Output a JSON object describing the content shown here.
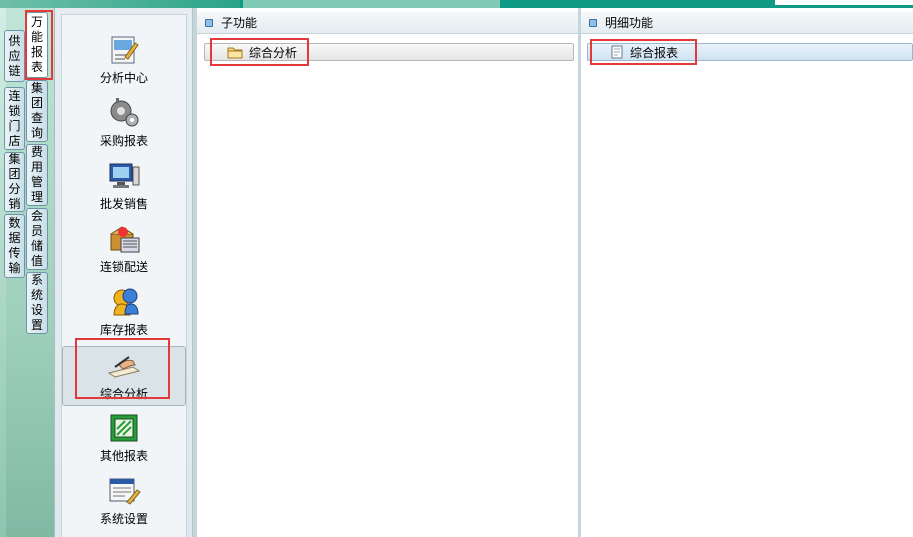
{
  "left_tabs": [
    {
      "label": "供应链"
    },
    {
      "label": "连锁门店"
    },
    {
      "label": "集团分销"
    },
    {
      "label": "数据传输"
    }
  ],
  "right_tabs": [
    {
      "label": "万能报表"
    },
    {
      "label": "集团查询"
    },
    {
      "label": "费用管理"
    },
    {
      "label": "会员储值"
    },
    {
      "label": "系统设置"
    }
  ],
  "nav": [
    {
      "label": "分析中心",
      "icon": "analysis-center-icon"
    },
    {
      "label": "采购报表",
      "icon": "purchase-report-icon"
    },
    {
      "label": "批发销售",
      "icon": "wholesale-sales-icon"
    },
    {
      "label": "连锁配送",
      "icon": "chain-distribution-icon"
    },
    {
      "label": "库存报表",
      "icon": "inventory-report-icon"
    },
    {
      "label": "综合分析",
      "icon": "comprehensive-analysis-icon",
      "active": true
    },
    {
      "label": "其他报表",
      "icon": "other-reports-icon"
    },
    {
      "label": "系统设置",
      "icon": "system-settings-icon"
    }
  ],
  "sub_function": {
    "header": "子功能",
    "items": [
      {
        "label": "综合分析",
        "icon": "folder-icon"
      }
    ]
  },
  "detail_function": {
    "header": "明细功能",
    "items": [
      {
        "label": "综合报表",
        "icon": "document-icon"
      }
    ]
  },
  "colors": {
    "highlight_border": "#e23a3a",
    "frame_green": "#9ed0bc",
    "top_strip": "#0f9a86"
  }
}
